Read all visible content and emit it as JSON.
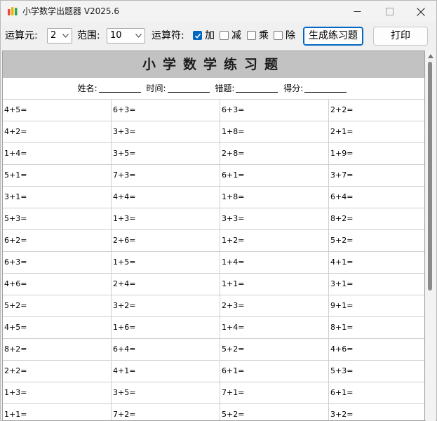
{
  "window": {
    "title": "小学数学出题器 V2025.6",
    "app_icon": "colored-bars-logo-icon"
  },
  "toolbar": {
    "operands_label": "运算元:",
    "operands_value": "2",
    "range_label": "范围:",
    "range_value": "10",
    "operator_label": "运算符:",
    "ops": [
      {
        "label": "加",
        "checked": true
      },
      {
        "label": "减",
        "checked": false
      },
      {
        "label": "乘",
        "checked": false
      },
      {
        "label": "除",
        "checked": false
      }
    ],
    "generate_label": "生成练习题",
    "print_label": "打印"
  },
  "sheet": {
    "title": "小学数学练习题",
    "name_label": "姓名:",
    "time_label": "时间:",
    "errors_label": "错题:",
    "score_label": "得分:",
    "rows": [
      [
        "4+5=",
        "6+3=",
        "6+3=",
        "2+2="
      ],
      [
        "4+2=",
        "3+3=",
        "1+8=",
        "2+1="
      ],
      [
        "1+4=",
        "3+5=",
        "2+8=",
        "1+9="
      ],
      [
        "5+1=",
        "7+3=",
        "6+1=",
        "3+7="
      ],
      [
        "3+1=",
        "4+4=",
        "1+8=",
        "6+4="
      ],
      [
        "5+3=",
        "1+3=",
        "3+3=",
        "8+2="
      ],
      [
        "6+2=",
        "2+6=",
        "1+2=",
        "5+2="
      ],
      [
        "6+3=",
        "1+5=",
        "1+4=",
        "4+1="
      ],
      [
        "4+6=",
        "2+4=",
        "1+1=",
        "3+1="
      ],
      [
        "5+2=",
        "3+2=",
        "2+3=",
        "9+1="
      ],
      [
        "4+5=",
        "1+6=",
        "1+4=",
        "8+1="
      ],
      [
        "8+2=",
        "6+4=",
        "5+2=",
        "4+6="
      ],
      [
        "2+2=",
        "4+1=",
        "6+1=",
        "5+3="
      ],
      [
        "1+3=",
        "3+5=",
        "7+1=",
        "6+1="
      ],
      [
        "1+1=",
        "7+2=",
        "5+2=",
        "3+2="
      ]
    ]
  },
  "colors": {
    "accent": "#0067c0",
    "title_band": "#c2c2c2",
    "gridline": "#cfcfcf"
  }
}
